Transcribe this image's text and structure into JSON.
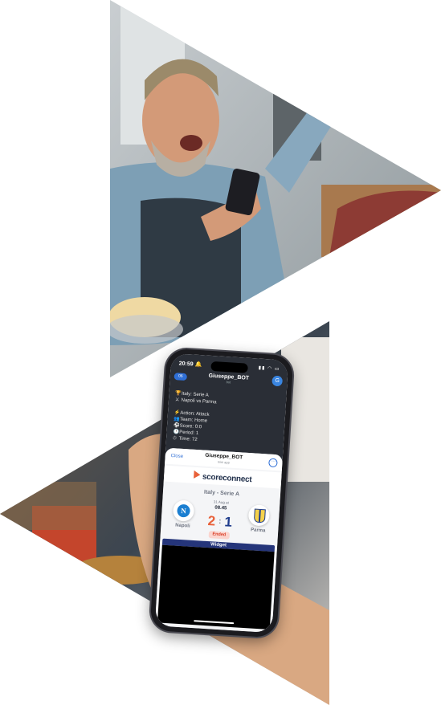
{
  "status_bar": {
    "time": "20:59 🔔",
    "signal": "▮▮ ◠ ▭"
  },
  "chat": {
    "back_label": "06",
    "title": "Giuseppe_BOT",
    "subtitle": "bot",
    "avatar_letter": "G",
    "message": {
      "league": "Italy: Serie A",
      "match": "Napoli vs Parma",
      "action": "Action: Attack",
      "team": "Team: Home",
      "score": "Score: 0:0",
      "period": "Period: 1",
      "time": "Time: 72"
    }
  },
  "miniapp": {
    "close_label": "Close",
    "title": "Giuseppe_BOT",
    "subtitle": "mini app",
    "more_label": "···"
  },
  "brand": {
    "name": "scoreconnect",
    "accent": "#e8613a",
    "text_color": "#23324d"
  },
  "match": {
    "league": "Italy - Serie A",
    "date": "31 Aug at",
    "kickoff": "08.45",
    "home_team": "Napoli",
    "away_team": "Parma",
    "home_score": "2",
    "separator": ":",
    "away_score": "1",
    "status": "Ended",
    "home_crest_letter": "N"
  },
  "widget": {
    "label": "Widget"
  },
  "colors": {
    "score_home": "#e8613a",
    "score_away": "#1f3c8c",
    "widget_bar": "#25357a"
  }
}
